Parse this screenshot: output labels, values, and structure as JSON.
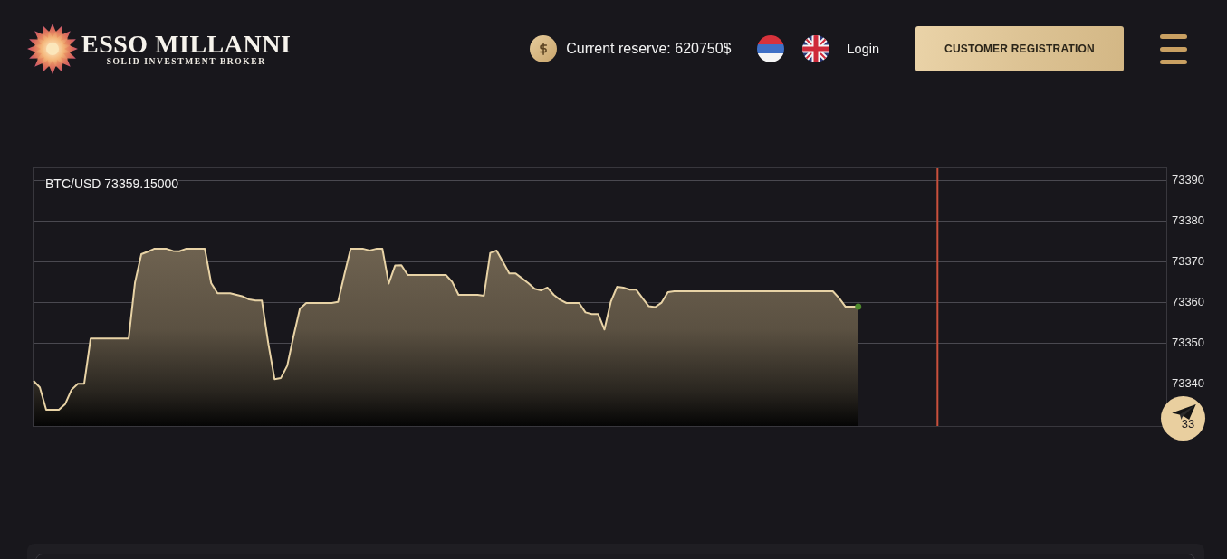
{
  "header": {
    "logo": {
      "title": "ESSO MILLANNI",
      "tagline": "SOLID INVESTMENT BROKER"
    },
    "reserve": {
      "label": "Current reserve: 620750$"
    },
    "languages": [
      {
        "kind": "serbian"
      },
      {
        "kind": "english"
      }
    ],
    "login": "Login",
    "register_button": "CUSTOMER REGISTRATION"
  },
  "chart": {
    "chart_data": {
      "type": "area",
      "title": "BTC/USD 73359.15000",
      "series": [
        {
          "color": "#e8d3a6",
          "values": [
            73340.7,
            73339.1,
            73333.6,
            73333.6,
            73333.6,
            73335,
            73338.5,
            73340,
            73340,
            73351.1,
            73351.1,
            73351.1,
            73351.1,
            73351.1,
            73351.1,
            73351.1,
            73364.9,
            73371.8,
            73372.4,
            73373.1,
            73373.1,
            73373.1,
            73372.6,
            73372.5,
            73373.1,
            73373.1,
            73373.1,
            73373.1,
            73364.7,
            73362.2,
            73362.2,
            73362.2,
            73361.8,
            73361.4,
            73360.7,
            73360.4,
            73360.4,
            73350,
            73341.1,
            73341.4,
            73344.4,
            73351.7,
            73358.4,
            73359.8,
            73359.8,
            73359.8,
            73359.8,
            73359.8,
            73360.1,
            73366.8,
            73373.1,
            73373.1,
            73373.1,
            73372.7,
            73373.1,
            73373.1,
            73364.6,
            73369,
            73369.1,
            73366.7,
            73366.7,
            73366.7,
            73366.7,
            73366.7,
            73366.7,
            73366.7,
            73365,
            73361.8,
            73361.8,
            73361.8,
            73361.8,
            73361.6,
            73372.1,
            73372.7,
            73369.9,
            73367.1,
            73367.1,
            73365.9,
            73364.7,
            73363.3,
            73362.9,
            73363.6,
            73361.8,
            73360.6,
            73359.8,
            73359.8,
            73359.8,
            73357.5,
            73357.1,
            73357.1,
            73353.3,
            73360.1,
            73363.8,
            73363.6,
            73363.1,
            73363.1,
            73361,
            73359,
            73358.8,
            73359.9,
            73362.5,
            73362.7,
            73362.7,
            73362.7,
            73362.7,
            73362.7,
            73362.7,
            73362.7,
            73362.7,
            73362.7,
            73362.7,
            73362.7,
            73362.7,
            73362.7,
            73362.7,
            73362.7,
            73362.7,
            73362.7,
            73362.7,
            73362.7,
            73362.7,
            73362.7,
            73362.7,
            73362.7,
            73362.7,
            73362.7,
            73362.7,
            73361,
            73358.9,
            73358.9,
            73358.9
          ]
        }
      ],
      "ylim": [
        73329.6,
        73392.9
      ],
      "yticks": [
        73340,
        73350,
        73360,
        73370,
        73380,
        73390
      ],
      "grid": true
    },
    "covered_axis_label": "33"
  }
}
